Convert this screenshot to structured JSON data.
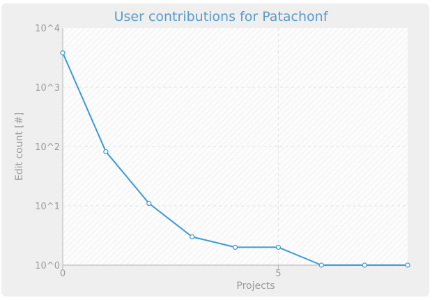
{
  "chart_data": {
    "type": "line",
    "title": "User contributions for Patachonf",
    "xlabel": "Projects",
    "ylabel": "Edit count [#]",
    "x": [
      0,
      1,
      2,
      3,
      4,
      5,
      6,
      7,
      8
    ],
    "series": [
      {
        "values": [
          3800,
          82,
          11,
          3,
          2,
          2,
          1,
          1,
          1
        ]
      }
    ],
    "xlim": [
      0,
      8
    ],
    "ylim": [
      1,
      10000
    ],
    "yscale": "log",
    "x_ticks": [
      "0",
      "5"
    ],
    "y_ticks": [
      "10^0",
      "10^1",
      "10^2",
      "10^3",
      "10^4"
    ],
    "grid": true,
    "colors": {
      "line": "#3a9ad9",
      "marker_fill": "#ffffff",
      "title": "#5b9bc8",
      "grid": "#e2e2e2",
      "plot_bg": "#fcfcfc",
      "frame": "#efefef",
      "text": "#9a9a9a"
    }
  }
}
